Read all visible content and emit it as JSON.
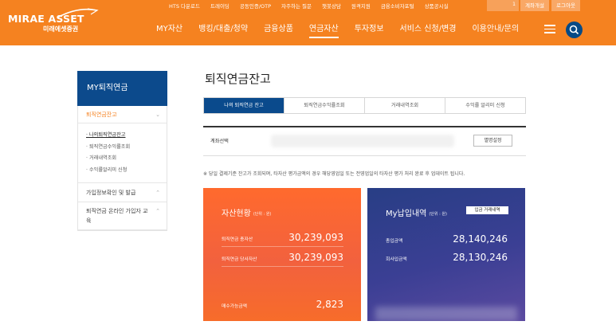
{
  "brand": {
    "name": "MIRAE ASSET",
    "sub": "미래에셋증권"
  },
  "utility": {
    "links": [
      "HTS 다운로드",
      "트레이딩",
      "공동인증/OTP",
      "자주하는 질문",
      "챗봇상담",
      "원격지원",
      "금융소비자포털",
      "상품공시실"
    ],
    "search_icon": "1",
    "open_account": "계좌개설",
    "logout": "로그아웃"
  },
  "gnb": [
    "MY자산",
    "뱅킹/대출/청약",
    "금융상품",
    "연금자산",
    "투자정보",
    "서비스 신청/변경",
    "이용안내/문의"
  ],
  "gnb_active_index": 3,
  "lnb": {
    "title": "MY퇴직연금",
    "active_section": "퇴직연금잔고",
    "sub_items": [
      "나의퇴직연금잔고",
      "퇴직연금수익률조회",
      "거래내역조회",
      "수익률알리미 신청"
    ],
    "section2": "가입정보확인 및 발급",
    "section3": "퇴직연금 온라인 가입자 교육"
  },
  "page": {
    "title": "퇴직연금잔고",
    "tabs": [
      "나의 퇴직연금 잔고",
      "퇴직연금수익률조회",
      "거래내역조회",
      "수익률 알리미 신청"
    ],
    "account_label": "계좌선택",
    "account_button": "별명설정",
    "notice": "※ 당일 결제기준 잔고가 조회되며, 타자산 평가금액의 경우 해당영업일 또는 전영업일의 타자산 평가 처리 완료 후 업데이트 됩니다."
  },
  "asset_card": {
    "title": "자산현황",
    "unit": "(단위 : 원)",
    "rows": [
      {
        "label": "퇴직연금 총자산",
        "value": "30,239,093"
      },
      {
        "label": "퇴직연금 당사자산",
        "value": "30,239,093"
      },
      {
        "label": "매수가능금액",
        "value": "2,823"
      }
    ]
  },
  "pay_card": {
    "title": "My납입내역",
    "unit": "(단위 : 원)",
    "link": "입금 거래내역",
    "rows": [
      {
        "label": "총입금액",
        "value": "28,140,246"
      },
      {
        "label": "회사입금액",
        "value": "28,130,246"
      }
    ]
  },
  "colors": {
    "brand_orange": "#f58220",
    "brand_navy": "#0c4a8c"
  }
}
